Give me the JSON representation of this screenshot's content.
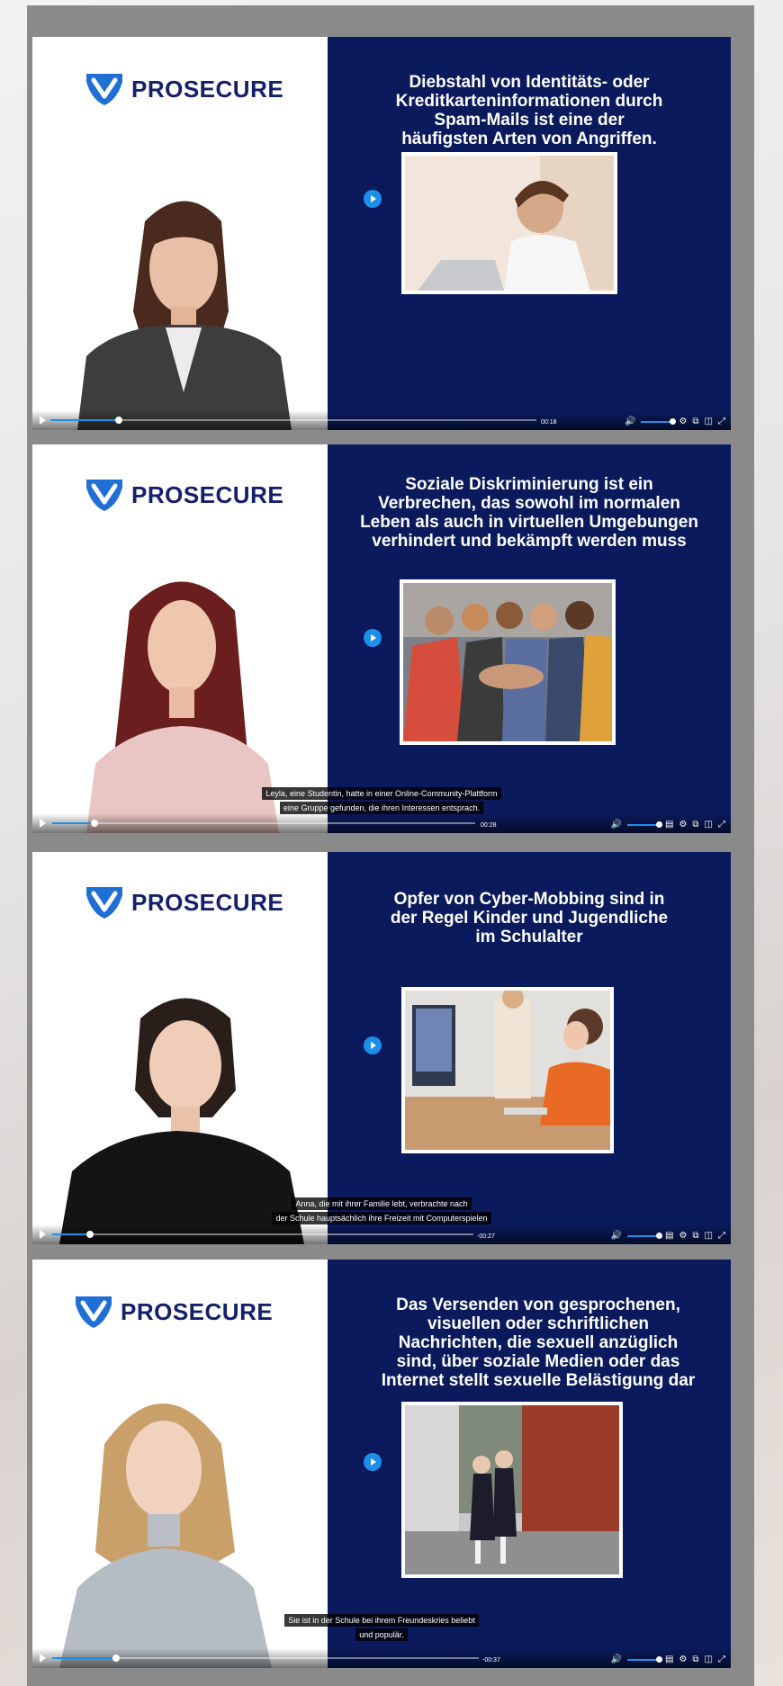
{
  "brand": {
    "name": "PROSECURE",
    "shield_color": "#1f6fd6",
    "navy": "#0a1a5c",
    "accent": "#1e8fe8"
  },
  "videos": [
    {
      "headline": "Diebstahl von Identitäts- oder\nKreditkarteninformationen durch\nSpam-Mails ist eine der\nhäufigsten Arten von Angriffen.",
      "caption_lines": [],
      "time": "00:18",
      "progress": 0.14
    },
    {
      "headline": "Soziale Diskriminierung ist ein\nVerbrechen, das sowohl im normalen\nLeben als auch in virtuellen Umgebungen\nverhindert und bekämpft werden muss",
      "caption_lines": [
        "Leyla, eine Studentin, hatte in einer Online-Community-Plattform",
        "eine Gruppe gefunden, die ihren Interessen entsprach."
      ],
      "time": "00:28",
      "progress": 0.1
    },
    {
      "headline": "Opfer von Cyber-Mobbing sind in\nder Regel Kinder und Jugendliche\nim Schulalter",
      "caption_lines": [
        "Anna, die mit ihrer Familie lebt, verbrachte nach",
        "der Schule hauptsächlich ihre Freizeit mit Computerspielen"
      ],
      "time": "-00:27",
      "progress": 0.09
    },
    {
      "headline": "Das Versenden von gesprochenen,\nvisuellen oder schriftlichen\nNachrichten, die sexuell anzüglich\nsind, über soziale Medien oder das\nInternet stellt sexuelle Belästigung dar",
      "caption_lines": [
        "Sie ist in der Schule bei ihrem Freundeskries beliebt",
        "und populär."
      ],
      "time": "-00:37",
      "progress": 0.15
    }
  ],
  "icons": [
    "play-icon",
    "volume-icon",
    "captions-icon",
    "settings-icon",
    "popout-icon",
    "chat-icon",
    "fullscreen-icon"
  ]
}
